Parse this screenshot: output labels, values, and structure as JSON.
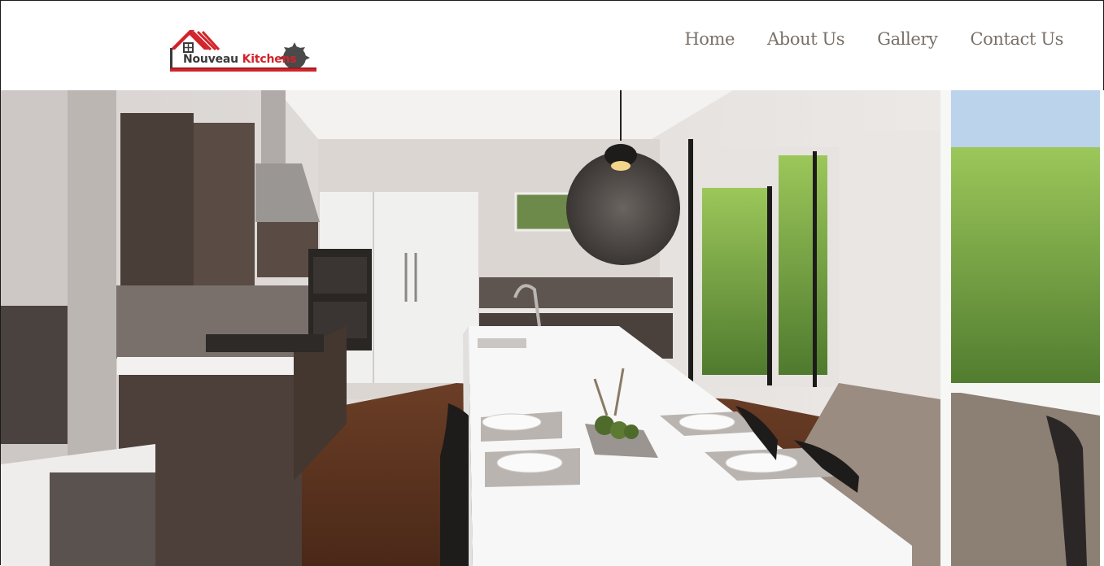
{
  "brand": {
    "name_part1": "Nouveau",
    "name_part2": "Kitchens",
    "accent_color": "#d2232a",
    "dark_color": "#3a3a3a",
    "icons": [
      "house-roof-icon",
      "saw-blade-icon"
    ]
  },
  "nav": {
    "items": [
      {
        "label": "Home"
      },
      {
        "label": "About Us"
      },
      {
        "label": "Gallery"
      },
      {
        "label": "Contact Us"
      }
    ],
    "text_color": "#7a7068"
  },
  "hero": {
    "subject": "modern kitchen photo"
  }
}
